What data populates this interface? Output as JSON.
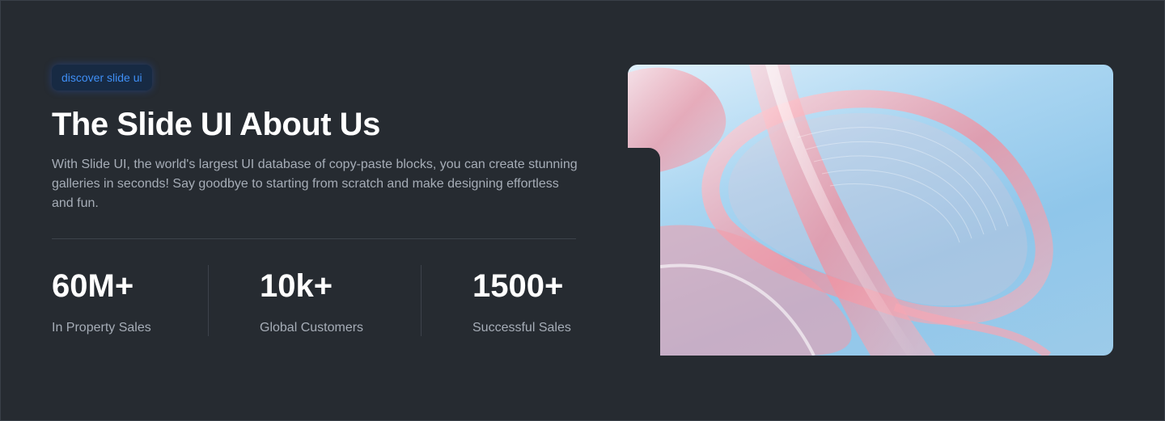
{
  "badge": "discover slide ui",
  "title": "The Slide UI About Us",
  "description": "With Slide UI, the world's largest UI database of copy-paste blocks, you can create stunning galleries in seconds! Say goodbye to starting from scratch and make designing effortless and fun.",
  "stats": [
    {
      "value": "60M+",
      "label": "In Property Sales"
    },
    {
      "value": "10k+",
      "label": "Global Customers"
    },
    {
      "value": "1500+",
      "label": "Successful Sales"
    }
  ],
  "hero_image": {
    "icon": "abstract-glass-waves-image"
  },
  "colors": {
    "background": "#262b31",
    "accent": "#3f8ff6",
    "muted_text": "#a6adb7"
  }
}
